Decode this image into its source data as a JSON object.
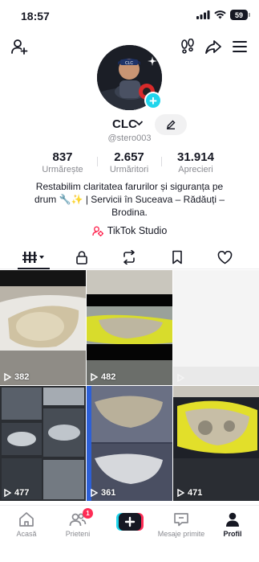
{
  "status_bar": {
    "time": "18:57",
    "battery": "59"
  },
  "profile": {
    "name": "CLC",
    "username": "@stero003",
    "stats": [
      {
        "value": "837",
        "label": "Urmărește"
      },
      {
        "value": "2.657",
        "label": "Urmăritori"
      },
      {
        "value": "31.914",
        "label": "Aprecieri"
      }
    ],
    "bio_line1": "Restabilim claritatea farurilor și siguranța pe",
    "bio_line2": "drum 🔧✨ | Servicii în Suceava – Rădăuți –",
    "bio_line3": "Brodina.",
    "studio_label": "TikTok Studio"
  },
  "tabs": [
    {
      "icon": "grid-icon",
      "active": true
    },
    {
      "icon": "lock-icon"
    },
    {
      "icon": "repost-icon"
    },
    {
      "icon": "bookmark-icon"
    },
    {
      "icon": "heart-icon"
    }
  ],
  "videos": [
    {
      "views": "382"
    },
    {
      "views": "482"
    },
    {
      "views": ""
    },
    {
      "views": "477"
    },
    {
      "views": "361"
    },
    {
      "views": "471"
    }
  ],
  "bottom_nav": {
    "home": "Acasă",
    "friends": "Prieteni",
    "friends_badge": "1",
    "inbox": "Mesaje primite",
    "profile": "Profil"
  },
  "colors": {
    "accent": "#fe2c55",
    "cyan": "#20d5ec",
    "text": "#161823",
    "muted": "#8a8b91"
  }
}
